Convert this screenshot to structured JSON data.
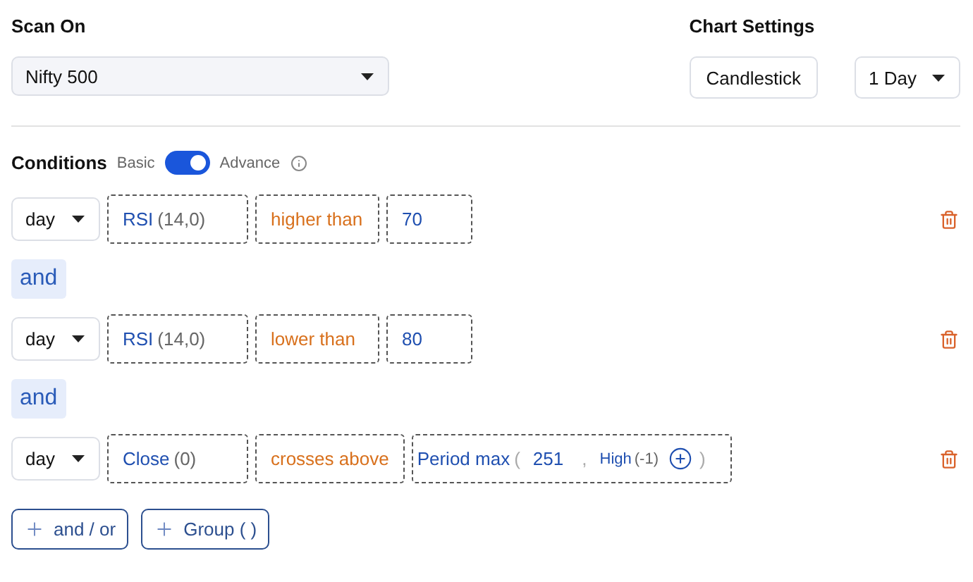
{
  "scan_on": {
    "label": "Scan On",
    "value": "Nifty 500"
  },
  "chart_settings": {
    "label": "Chart Settings",
    "chart_type": "Candlestick",
    "interval": "1 Day"
  },
  "conditions": {
    "label": "Conditions",
    "mode_off": "Basic",
    "mode_on": "Advance",
    "advanced": true
  },
  "items": [
    {
      "kind": "condition",
      "timeframe": "day",
      "parts": [
        {
          "kind": "indicator",
          "name": "RSI",
          "params": "(14,0)"
        },
        {
          "kind": "operator",
          "text": "higher than"
        },
        {
          "kind": "value",
          "text": "70"
        }
      ]
    },
    {
      "kind": "connector",
      "text": "and"
    },
    {
      "kind": "condition",
      "timeframe": "day",
      "parts": [
        {
          "kind": "indicator",
          "name": "RSI",
          "params": "(14,0)"
        },
        {
          "kind": "operator",
          "text": "lower than"
        },
        {
          "kind": "value",
          "text": "80"
        }
      ]
    },
    {
      "kind": "connector",
      "text": "and"
    },
    {
      "kind": "condition",
      "timeframe": "day",
      "parts": [
        {
          "kind": "indicator",
          "name": "Close",
          "params": "(0)"
        },
        {
          "kind": "operator",
          "text": "crosses above"
        },
        {
          "kind": "function",
          "name": "Period max",
          "open": "(",
          "separator": ",",
          "close": ")",
          "args": [
            {
              "kind": "value",
              "text": "251"
            },
            {
              "kind": "indicator",
              "name": "High",
              "params": "(-1)"
            }
          ]
        }
      ]
    }
  ],
  "buttons": [
    "and / or",
    "Group ( )"
  ]
}
